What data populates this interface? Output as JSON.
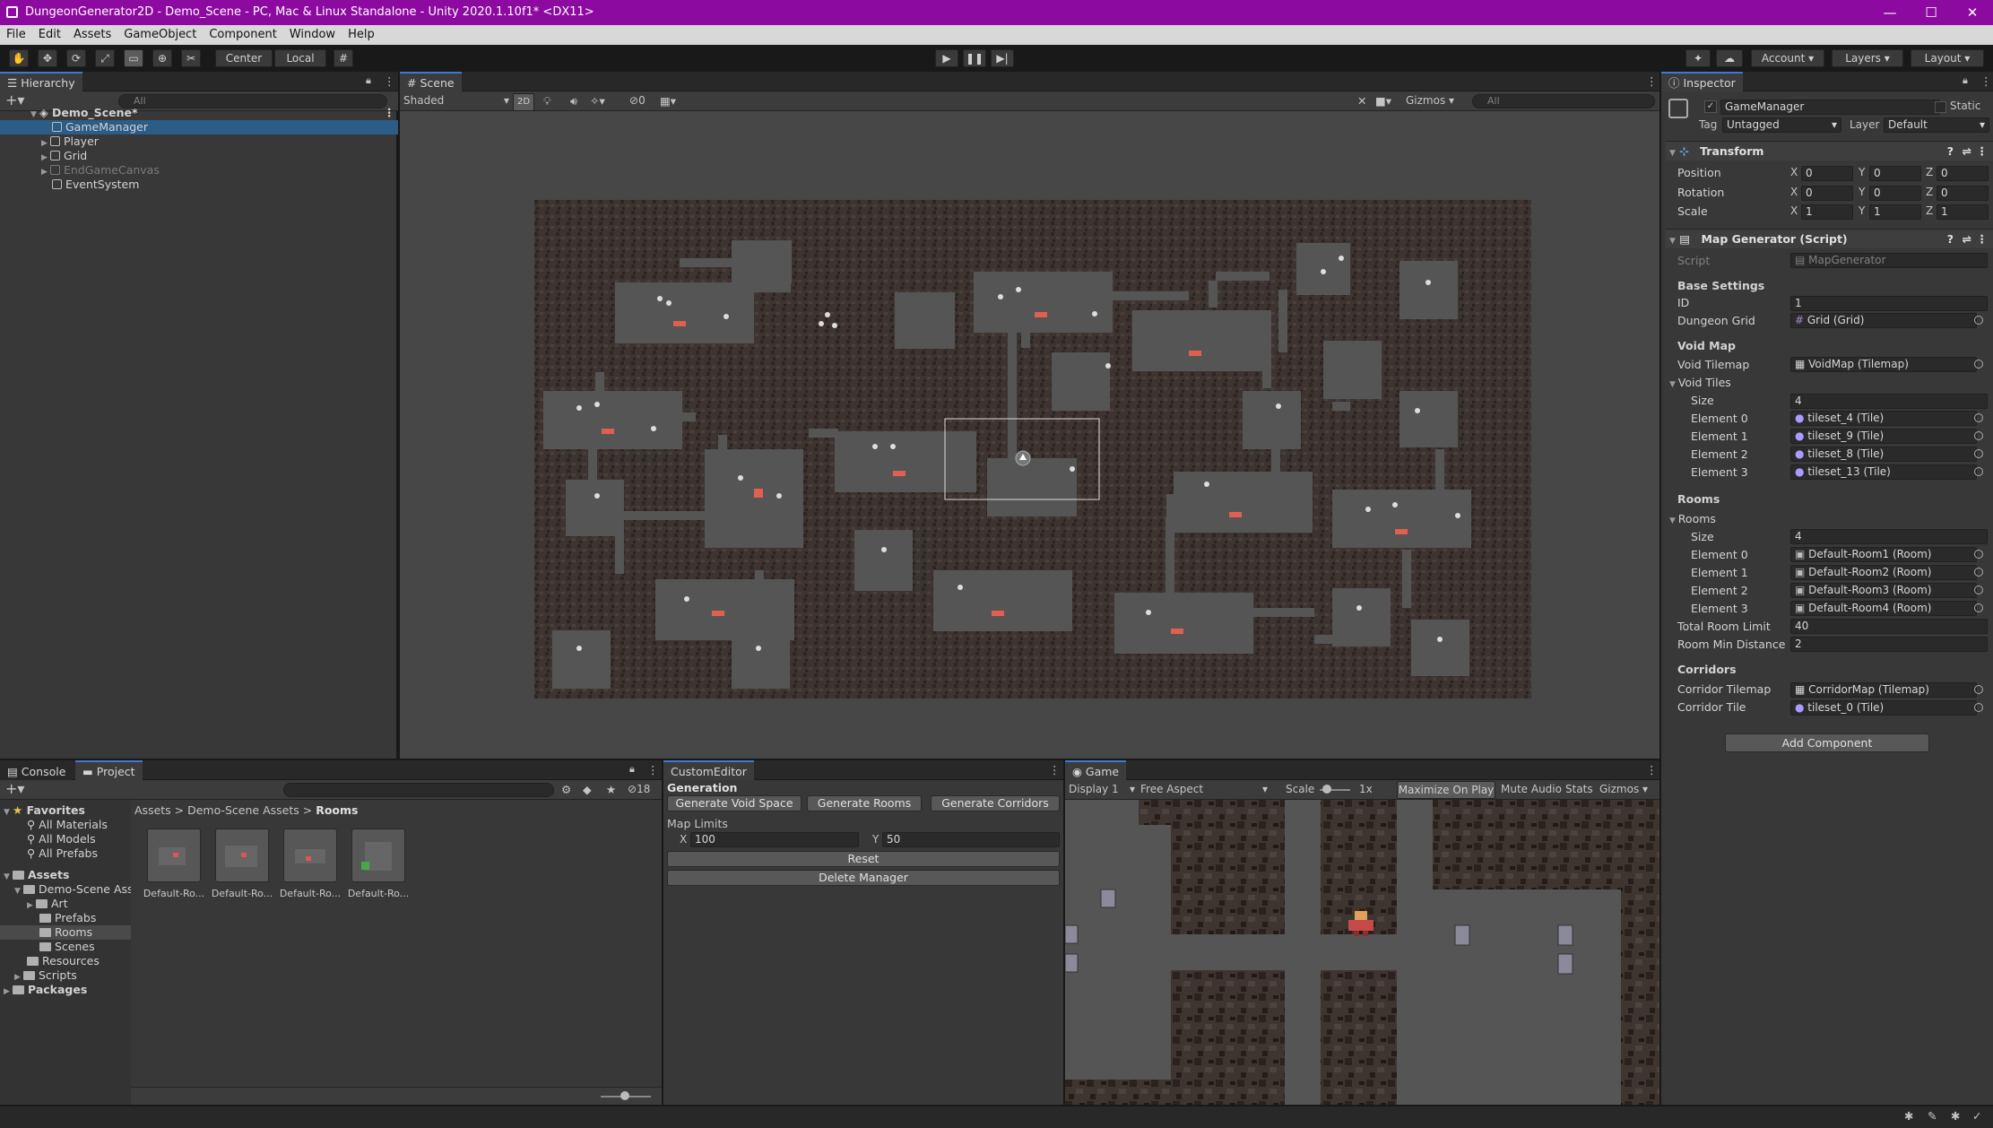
{
  "window": {
    "title": "DungeonGenerator2D - Demo_Scene - PC, Mac & Linux Standalone - Unity 2020.1.10f1* <DX11>",
    "minimize": "—",
    "maximize": "☐",
    "close": "✕"
  },
  "menu": [
    "File",
    "Edit",
    "Assets",
    "GameObject",
    "Component",
    "Window",
    "Help"
  ],
  "toolbar": {
    "pivot": "Center",
    "space": "Local",
    "account": "Account",
    "layers": "Layers",
    "layout": "Layout"
  },
  "hierarchy": {
    "tab": "Hierarchy",
    "search_placeholder": "All",
    "scene": "Demo_Scene*",
    "items": [
      {
        "label": "GameManager",
        "selected": true
      },
      {
        "label": "Player"
      },
      {
        "label": "Grid"
      },
      {
        "label": "EndGameCanvas",
        "disabled": true
      },
      {
        "label": "EventSystem"
      }
    ]
  },
  "scene": {
    "tab": "Scene",
    "shading": "Shaded",
    "mode2d": "2D",
    "hidden_count": "0",
    "gizmos": "Gizmos",
    "search_placeholder": "All"
  },
  "inspector": {
    "tab": "Inspector",
    "object_name": "GameManager",
    "static": "Static",
    "tag_label": "Tag",
    "tag": "Untagged",
    "layer_label": "Layer",
    "layer": "Default",
    "transform": {
      "title": "Transform",
      "position_label": "Position",
      "rotation_label": "Rotation",
      "scale_label": "Scale",
      "position": {
        "x": "0",
        "y": "0",
        "z": "0"
      },
      "rotation": {
        "x": "0",
        "y": "0",
        "z": "0"
      },
      "scale": {
        "x": "1",
        "y": "1",
        "z": "1"
      }
    },
    "map_generator": {
      "title": "Map Generator (Script)",
      "script_label": "Script",
      "script": "MapGenerator",
      "base_settings": "Base Settings",
      "id_label": "ID",
      "id": "1",
      "dungeon_grid_label": "Dungeon Grid",
      "dungeon_grid": "Grid (Grid)",
      "void_map": "Void Map",
      "void_tilemap_label": "Void Tilemap",
      "void_tilemap": "VoidMap (Tilemap)",
      "void_tiles_label": "Void Tiles",
      "size_label": "Size",
      "void_tiles_size": "4",
      "void_tiles": [
        {
          "label": "Element 0",
          "value": "tileset_4 (Tile)"
        },
        {
          "label": "Element 1",
          "value": "tileset_9 (Tile)"
        },
        {
          "label": "Element 2",
          "value": "tileset_8 (Tile)"
        },
        {
          "label": "Element 3",
          "value": "tileset_13 (Tile)"
        }
      ],
      "rooms_header": "Rooms",
      "rooms_label": "Rooms",
      "rooms_size": "4",
      "rooms": [
        {
          "label": "Element 0",
          "value": "Default-Room1 (Room)"
        },
        {
          "label": "Element 1",
          "value": "Default-Room2 (Room)"
        },
        {
          "label": "Element 2",
          "value": "Default-Room3 (Room)"
        },
        {
          "label": "Element 3",
          "value": "Default-Room4 (Room)"
        }
      ],
      "total_room_limit_label": "Total Room Limit",
      "total_room_limit": "40",
      "room_min_distance_label": "Room Min Distance",
      "room_min_distance": "2",
      "corridors": "Corridors",
      "corridor_tilemap_label": "Corridor Tilemap",
      "corridor_tilemap": "CorridorMap (Tilemap)",
      "corridor_tile_label": "Corridor Tile",
      "corridor_tile": "tileset_0 (Tile)"
    },
    "add_component": "Add Component"
  },
  "project": {
    "console_tab": "Console",
    "project_tab": "Project",
    "count": "18",
    "favorites": "Favorites",
    "fav_items": [
      "All Materials",
      "All Models",
      "All Prefabs"
    ],
    "assets": "Assets",
    "tree": [
      "Demo-Scene Ass",
      "Art",
      "Prefabs",
      "Rooms",
      "Scenes",
      "Resources",
      "Scripts"
    ],
    "packages": "Packages",
    "breadcrumb": [
      "Assets",
      "Demo-Scene Assets",
      "Rooms"
    ],
    "thumbs": [
      "Default-Ro...",
      "Default-Ro...",
      "Default-Ro...",
      "Default-Ro..."
    ]
  },
  "custom_editor": {
    "tab": "CustomEditor",
    "generation": "Generation",
    "gen_void": "Generate Void Space",
    "gen_rooms": "Generate Rooms",
    "gen_corridors": "Generate Corridors",
    "map_limits": "Map Limits",
    "x_label": "X",
    "x": "100",
    "y_label": "Y",
    "y": "50",
    "reset": "Reset",
    "delete": "Delete Manager"
  },
  "game": {
    "tab": "Game",
    "display": "Display 1",
    "aspect": "Free Aspect",
    "scale_label": "Scale",
    "scale": "1x",
    "maximize": "Maximize On Play",
    "mute": "Mute Audio",
    "stats": "Stats",
    "gizmos": "Gizmos"
  },
  "colors": {
    "titlebar": "#8c0aa0",
    "selection": "#2c5d87",
    "room_floor": "#555555",
    "void_tile": "#3f3530"
  }
}
